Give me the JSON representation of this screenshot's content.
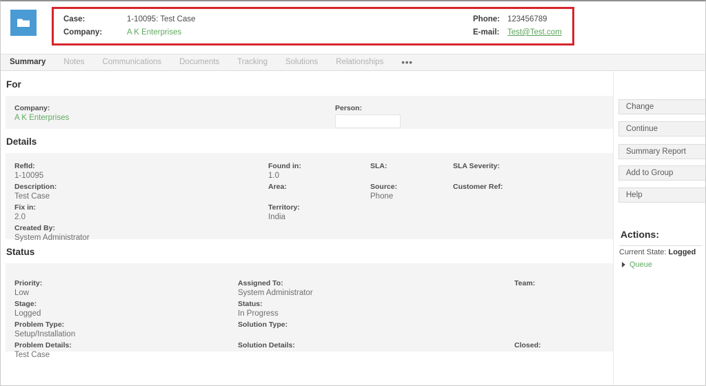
{
  "app": {
    "icon": "folder-icon",
    "icon_color": "#4a9ad4",
    "accent_red": "#d5252b",
    "link_green": "#62ab62"
  },
  "header": {
    "case_label": "Case:",
    "case_value": "1-10095: Test Case",
    "company_label": "Company:",
    "company_value": "A K Enterprises",
    "phone_label": "Phone:",
    "phone_value": "123456789",
    "email_label": "E-mail:",
    "email_value": "Test@Test.com"
  },
  "tabs": [
    {
      "label": "Summary",
      "active": true
    },
    {
      "label": "Notes",
      "active": false
    },
    {
      "label": "Communications",
      "active": false
    },
    {
      "label": "Documents",
      "active": false
    },
    {
      "label": "Tracking",
      "active": false
    },
    {
      "label": "Solutions",
      "active": false
    },
    {
      "label": "Relationships",
      "active": false
    },
    {
      "label": "•••",
      "active": false
    }
  ],
  "sections": {
    "for": {
      "title": "For",
      "company_label": "Company:",
      "company_value": "A K Enterprises",
      "person_label": "Person:",
      "person_value": ""
    },
    "details": {
      "title": "Details",
      "refid_label": "RefId:",
      "refid_value": "1-10095",
      "description_label": "Description:",
      "description_value": "Test Case",
      "fixin_label": "Fix in:",
      "fixin_value": "2.0",
      "createdby_label": "Created By:",
      "createdby_value": "System Administrator",
      "foundin_label": "Found in:",
      "foundin_value": "1.0",
      "area_label": "Area:",
      "area_value": "",
      "territory_label": "Territory:",
      "territory_value": "India",
      "sla_label": "SLA:",
      "sla_value": "",
      "source_label": "Source:",
      "source_value": "Phone",
      "slaseverity_label": "SLA Severity:",
      "slaseverity_value": "",
      "customerref_label": "Customer Ref:",
      "customerref_value": ""
    },
    "status": {
      "title": "Status",
      "priority_label": "Priority:",
      "priority_value": "Low",
      "stage_label": "Stage:",
      "stage_value": "Logged",
      "problemtype_label": "Problem Type:",
      "problemtype_value": "Setup/Installation",
      "problemdetails_label": "Problem Details:",
      "problemdetails_value": "Test Case",
      "assignedto_label": "Assigned To:",
      "assignedto_value": "System Administrator",
      "status_label": "Status:",
      "status_value": "In Progress",
      "solutiontype_label": "Solution Type:",
      "solutiontype_value": "",
      "solutiondetails_label": "Solution Details:",
      "solutiondetails_value": "",
      "team_label": "Team:",
      "team_value": "",
      "closed_label": "Closed:",
      "closed_value": ""
    }
  },
  "sidebar": {
    "buttons": [
      {
        "label": "Change"
      },
      {
        "label": "Continue"
      },
      {
        "label": "Summary Report"
      },
      {
        "label": "Add to Group"
      },
      {
        "label": "Help"
      }
    ],
    "actions_title": "Actions:",
    "current_state_label": "Current State:",
    "current_state_value": "Logged",
    "queue_label": "Queue"
  }
}
